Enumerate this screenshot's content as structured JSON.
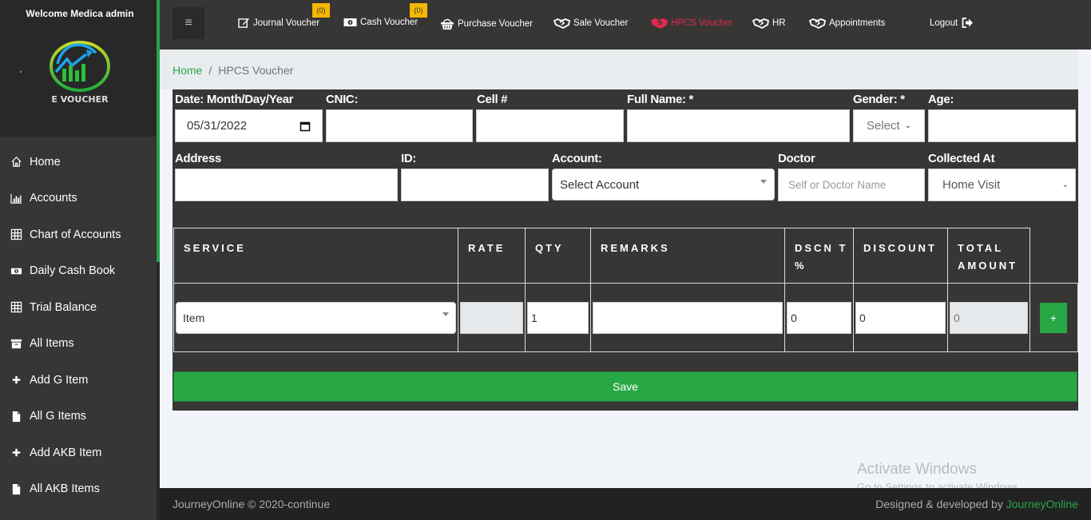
{
  "sidebar": {
    "welcome": "Welcome Medica admin",
    "logo_text": "E VOUCHER",
    "items": [
      {
        "label": "Home",
        "icon": "home-icon"
      },
      {
        "label": "Accounts",
        "icon": "bar-chart-icon"
      },
      {
        "label": "Chart of Accounts",
        "icon": "grid-icon"
      },
      {
        "label": "Daily Cash Book",
        "icon": "money-icon"
      },
      {
        "label": "Trial Balance",
        "icon": "grid-icon"
      },
      {
        "label": "All Items",
        "icon": "archive-icon"
      },
      {
        "label": "Add G Item",
        "icon": "plus-icon"
      },
      {
        "label": "All G Items",
        "icon": "file-icon"
      },
      {
        "label": "Add AKB Item",
        "icon": "plus-icon"
      },
      {
        "label": "All AKB Items",
        "icon": "file-icon"
      }
    ]
  },
  "topbar": {
    "menu_icon": "≡",
    "items": [
      {
        "label": "Journal Voucher",
        "icon": "edit-icon",
        "badge": "(0)"
      },
      {
        "label": "Cash Voucher",
        "icon": "money-icon",
        "badge": "(0)"
      },
      {
        "label": "Purchase Voucher",
        "icon": "basket-icon"
      },
      {
        "label": "Sale Voucher",
        "icon": "handshake-icon"
      },
      {
        "label": "HPCS Voucher",
        "icon": "handshake-icon",
        "active": true
      },
      {
        "label": "HR",
        "icon": "handshake-icon"
      },
      {
        "label": "Appointments",
        "icon": "handshake-icon"
      },
      {
        "label": "Logout",
        "icon": "logout-icon"
      }
    ],
    "active_color": "#e0294f"
  },
  "breadcrumb": {
    "home": "Home",
    "separator": "/",
    "current": "HPCS Voucher"
  },
  "form": {
    "date": {
      "label": "Date: Month/Day/Year",
      "value": "05/31/2022"
    },
    "cnic": {
      "label": "CNIC:",
      "value": ""
    },
    "cell": {
      "label": "Cell #",
      "value": ""
    },
    "full_name": {
      "label": "Full Name: *",
      "value": ""
    },
    "gender": {
      "label": "Gender: *",
      "value": "Select"
    },
    "age": {
      "label": "Age:",
      "value": ""
    },
    "address": {
      "label": "Address",
      "value": ""
    },
    "id": {
      "label": "ID:",
      "value": ""
    },
    "account": {
      "label": "Account:",
      "value": "Select Account"
    },
    "doctor": {
      "label": "Doctor",
      "placeholder": "Self or Doctor Name"
    },
    "collected_at": {
      "label": "Collected At",
      "value": "Home Visit"
    }
  },
  "table": {
    "headers": [
      "SERVICE",
      "RATE",
      "QTY",
      "REMARKS",
      "DSCN T %",
      "DISCOUNT",
      "TOTAL AMOUNT"
    ],
    "rows": [
      {
        "service": "Item",
        "rate": "",
        "qty": "1",
        "remarks": "",
        "dscnt_pct": "0",
        "discount": "0",
        "total": "0"
      }
    ],
    "add_label": "+"
  },
  "save_label": "Save",
  "footer": {
    "left": "JourneyOnline © 2020-continue",
    "right_prefix": "Designed & developed by ",
    "right_brand": "JourneyOnline"
  },
  "watermark": {
    "title": "Activate Windows",
    "subtitle": "Go to Settings to activate Windows."
  },
  "colors": {
    "accent_green": "#28a745",
    "badge_yellow": "#f5b800",
    "panel_dark": "#383634"
  }
}
